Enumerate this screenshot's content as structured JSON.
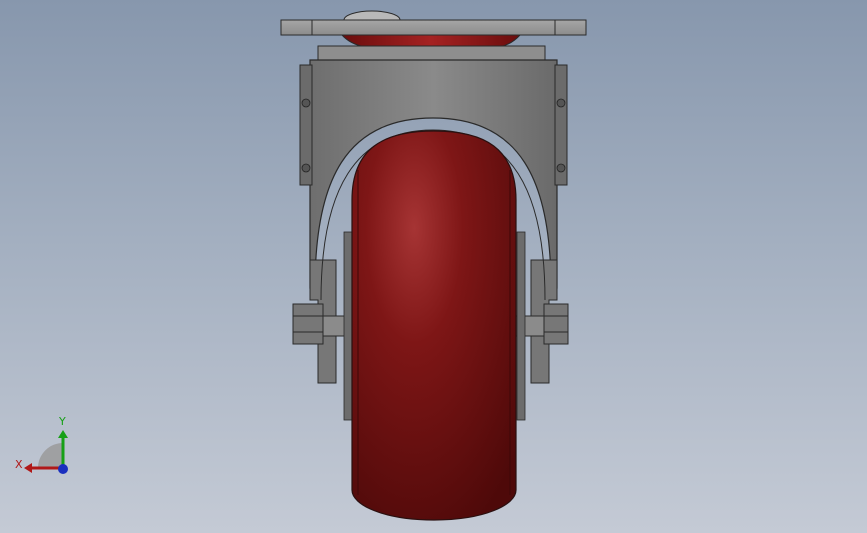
{
  "viewport": {
    "model": "caster-wheel-front-view",
    "background_top": "#8797ad",
    "background_bottom": "#c4cad5",
    "colors": {
      "wheel": "#7a1414",
      "wheel_highlight": "#9b2a2a",
      "wheel_dark": "#4e0a0a",
      "steel": "#7f7f7f",
      "steel_light": "#a2a2a2",
      "steel_dark": "#5a5a5a",
      "outline": "#2a2a2a"
    }
  },
  "triad": {
    "x_label": "X",
    "y_label": "Y",
    "x_color": "#b01818",
    "y_color": "#17a017",
    "z_color": "#1a2fbf"
  }
}
